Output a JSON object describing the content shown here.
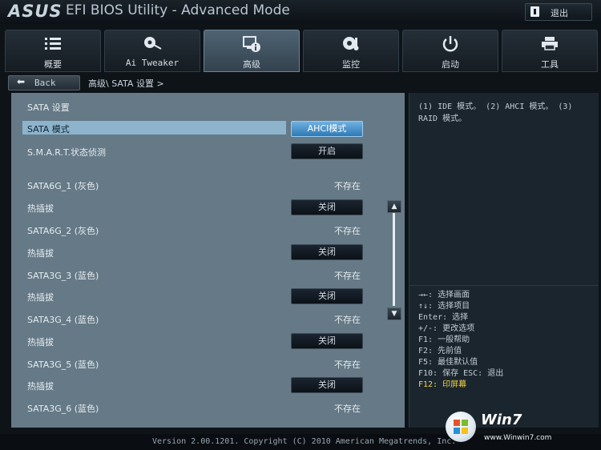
{
  "titlebar": {
    "logo": "ASUS",
    "title": "EFI BIOS Utility - Advanced Mode",
    "exit_label": "退出"
  },
  "tabs": [
    {
      "label": "概要",
      "icon": "list-icon"
    },
    {
      "label": "Ai Tweaker",
      "icon": "fan-icon"
    },
    {
      "label": "高级",
      "icon": "info-monitor-icon"
    },
    {
      "label": "监控",
      "icon": "thermometer-icon"
    },
    {
      "label": "启动",
      "icon": "power-icon"
    },
    {
      "label": "工具",
      "icon": "printer-icon"
    }
  ],
  "active_tab": "高级",
  "nav": {
    "back_label": "Back",
    "breadcrumb": "高级\\ SATA 设置 >"
  },
  "main": {
    "section_title": "SATA 设置",
    "sata_mode": {
      "label": "SATA 模式",
      "value": "AHCI模式"
    },
    "smart": {
      "label": "S.M.A.R.T.状态侦测",
      "value": "开启"
    },
    "ports": [
      {
        "name": "SATA6G_1 (灰色)",
        "status": "不存在",
        "hotplug_label": "热插拔",
        "hotplug_value": "关闭"
      },
      {
        "name": "SATA6G_2 (灰色)",
        "status": "不存在",
        "hotplug_label": "热插拔",
        "hotplug_value": "关闭"
      },
      {
        "name": "SATA3G_3 (蓝色)",
        "status": "不存在",
        "hotplug_label": "热插拔",
        "hotplug_value": "关闭"
      },
      {
        "name": "SATA3G_4 (蓝色)",
        "status": "不存在",
        "hotplug_label": "热插拔",
        "hotplug_value": "关闭"
      },
      {
        "name": "SATA3G_5 (蓝色)",
        "status": "不存在",
        "hotplug_label": "热插拔",
        "hotplug_value": "关闭"
      },
      {
        "name": "SATA3G_6 (蓝色)",
        "status": "不存在"
      }
    ]
  },
  "help": {
    "description": "(1) IDE 模式。 (2) AHCI 模式。 (3) RAID 模式。",
    "keys": [
      "→←: 选择画面",
      "↑↓: 选择项目",
      "Enter: 选择",
      "+/-: 更改选项",
      "F1: 一般帮助",
      "F2: 先前值",
      "F5: 最佳默认值",
      "F10: 保存  ESC: 退出",
      "F12: 印屏幕"
    ]
  },
  "footer": {
    "version": "Version 2.00.1201. Copyright (C) 2010 American Megatrends, Inc."
  },
  "watermark": {
    "brand": "Win7",
    "site": "www.Winwin7.com"
  },
  "colors": {
    "panel": "#657986",
    "highlight": "#8eb4cd",
    "accent_button": "#2f79b5",
    "key_highlight": "#f1d34a"
  }
}
